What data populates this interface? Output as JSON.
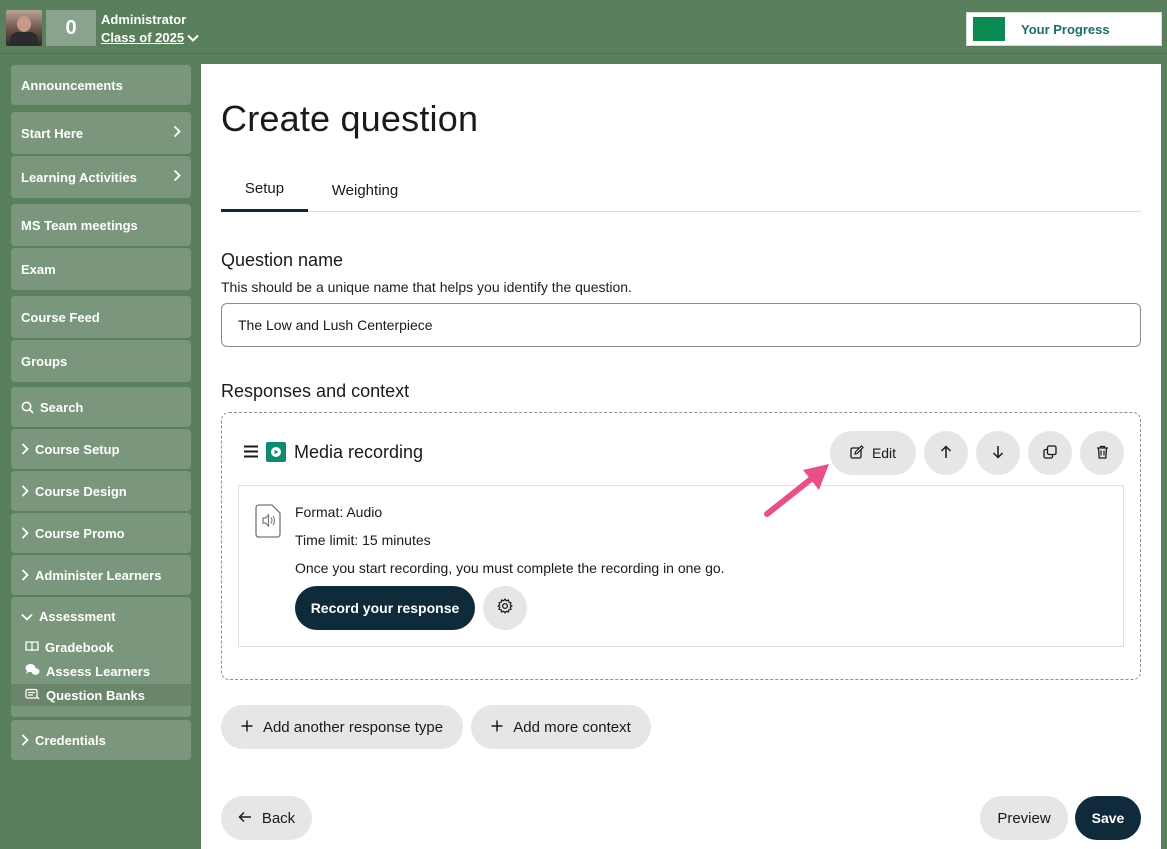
{
  "header": {
    "score": "0",
    "role": "Administrator",
    "class_name": "Class of 2025",
    "progress_label": "Your Progress",
    "progress_color": "#0a8a51"
  },
  "sidebar": {
    "items": [
      {
        "label": "Announcements"
      },
      {
        "label": "Start Here"
      },
      {
        "label": "Learning Activities"
      },
      {
        "label": "MS Team meetings"
      },
      {
        "label": "Exam"
      },
      {
        "label": "Course Feed"
      },
      {
        "label": "Groups"
      },
      {
        "label": "Search"
      },
      {
        "label": "Course Setup"
      },
      {
        "label": "Course Design"
      },
      {
        "label": "Course Promo"
      },
      {
        "label": "Administer Learners"
      }
    ],
    "assessment": {
      "label": "Assessment",
      "children": [
        {
          "label": "Gradebook"
        },
        {
          "label": "Assess Learners"
        },
        {
          "label": "Question Banks"
        }
      ]
    },
    "credentials": {
      "label": "Credentials"
    }
  },
  "main": {
    "title": "Create question",
    "tabs": [
      {
        "label": "Setup",
        "active": true
      },
      {
        "label": "Weighting",
        "active": false
      }
    ],
    "question_name": {
      "heading": "Question name",
      "help": "This should be a unique name that helps you identify the question.",
      "value": "The Low and Lush Centerpiece"
    },
    "responses": {
      "heading": "Responses and context",
      "item_title": "Media recording",
      "edit_label": "Edit",
      "format": "Format: Audio",
      "time_limit": "Time limit: 15 minutes",
      "notice": "Once you start recording, you must complete the recording in one go.",
      "record_label": "Record your response"
    },
    "add_response_label": "Add another response type",
    "add_context_label": "Add more context",
    "back_label": "Back",
    "preview_label": "Preview",
    "save_label": "Save"
  },
  "colors": {
    "header_bg": "#5a7f5d",
    "nav_item_bg": "#7a977d",
    "primary_dark": "#0f2a3a",
    "annotation_arrow": "#e8508a"
  }
}
